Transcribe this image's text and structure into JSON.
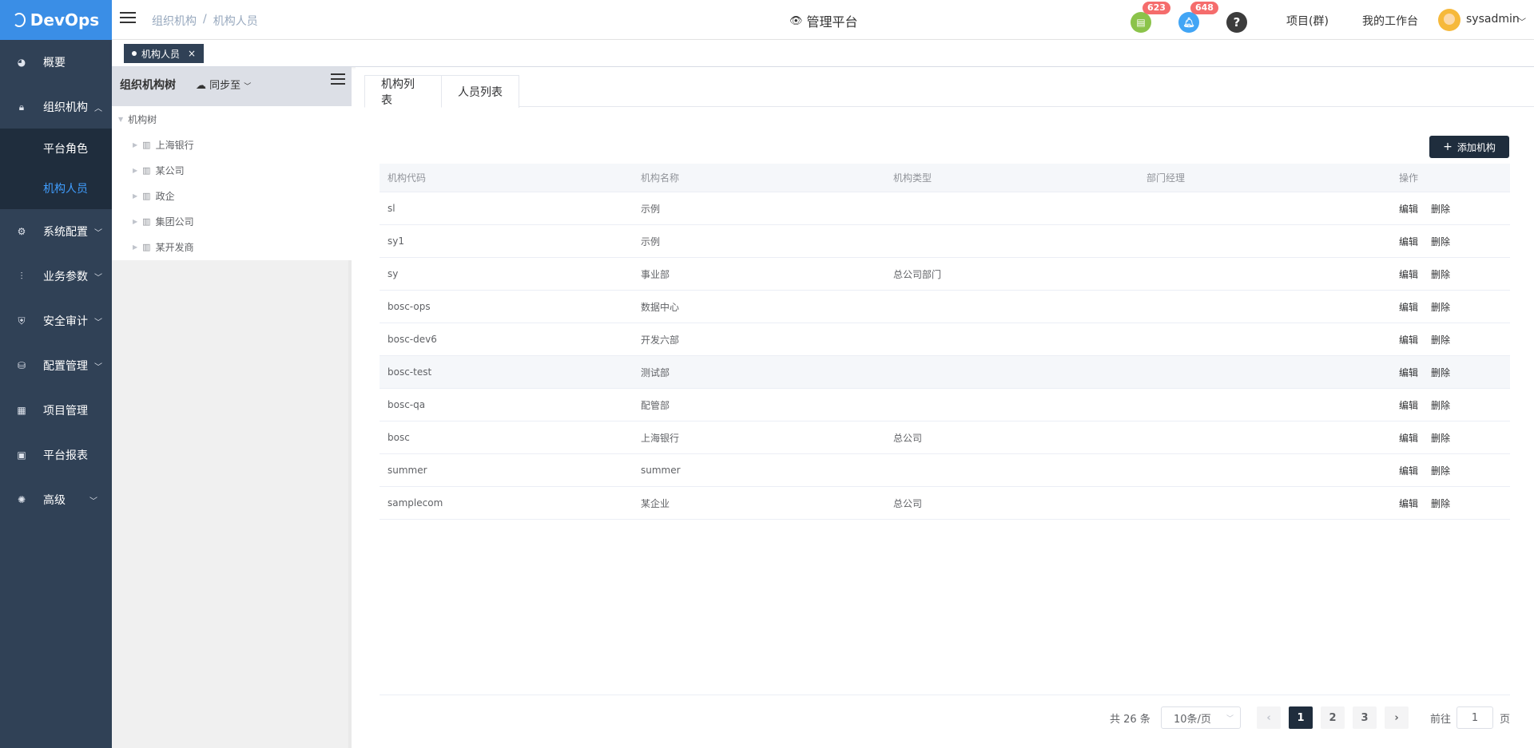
{
  "app": {
    "name": "DevOps"
  },
  "header": {
    "breadcrumb": [
      "组织机构",
      "/",
      "机构人员"
    ],
    "platform_title": "管理平台",
    "doc_badge": "623",
    "bell_badge": "648",
    "help_label": "?",
    "project_link": "项目(群)",
    "workspace_link": "我的工作台",
    "username": "sysadmin"
  },
  "sidebar": {
    "items": [
      {
        "label": "概要"
      },
      {
        "label": "组织机构"
      },
      {
        "label": "系统配置"
      },
      {
        "label": "业务参数"
      },
      {
        "label": "安全审计"
      },
      {
        "label": "配置管理"
      },
      {
        "label": "项目管理"
      },
      {
        "label": "平台报表"
      },
      {
        "label": "高级"
      }
    ],
    "submenu": [
      {
        "label": "平台角色"
      },
      {
        "label": "机构人员"
      }
    ]
  },
  "tags": {
    "active_tag": "机构人员",
    "close": "×"
  },
  "tree": {
    "title": "组织机构树",
    "sync_label": "同步至",
    "root": "机构树",
    "nodes": [
      "上海银行",
      "某公司",
      "政企",
      "集团公司",
      "某开发商"
    ]
  },
  "main": {
    "tabs": [
      "机构列表",
      "人员列表"
    ],
    "add_button": "添加机构",
    "columns": [
      "机构代码",
      "机构名称",
      "机构类型",
      "部门经理",
      "操作"
    ],
    "rows": [
      {
        "code": "sl",
        "name": "示例",
        "type": "",
        "manager": ""
      },
      {
        "code": "sy1",
        "name": "示例",
        "type": "",
        "manager": ""
      },
      {
        "code": "sy",
        "name": "事业部",
        "type": "总公司部门",
        "manager": ""
      },
      {
        "code": "bosc-ops",
        "name": "数据中心",
        "type": "",
        "manager": ""
      },
      {
        "code": "bosc-dev6",
        "name": "开发六部",
        "type": "",
        "manager": ""
      },
      {
        "code": "bosc-test",
        "name": "测试部",
        "type": "",
        "manager": ""
      },
      {
        "code": "bosc-qa",
        "name": "配管部",
        "type": "",
        "manager": ""
      },
      {
        "code": "bosc",
        "name": "上海银行",
        "type": "总公司",
        "manager": ""
      },
      {
        "code": "summer",
        "name": "summer",
        "type": "",
        "manager": ""
      },
      {
        "code": "samplecom",
        "name": "某企业",
        "type": "总公司",
        "manager": ""
      }
    ],
    "edit_label": "编辑",
    "delete_label": "删除"
  },
  "pagination": {
    "total": "共 26 条",
    "page_size": "10条/页",
    "pages": [
      "1",
      "2",
      "3"
    ],
    "prev": "‹",
    "next": "›",
    "goto_label": "前往",
    "goto_value": "1",
    "page_label": "页"
  },
  "colors": {
    "sidebar": "#304156",
    "accent": "#409eff",
    "logo_bg": "#3a8ee6",
    "badge": "#f56c6c"
  }
}
